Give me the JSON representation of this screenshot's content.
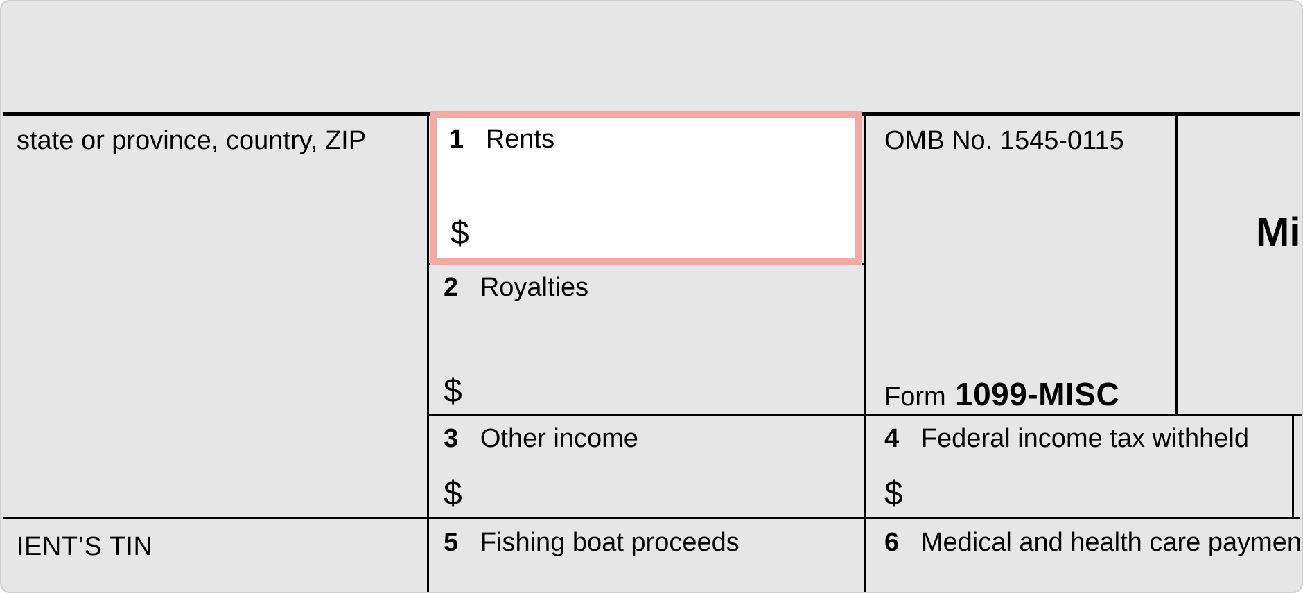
{
  "payer_address_fragment": "state or province, country, ZIP",
  "omb_number": "OMB No. 1545-0115",
  "title_fragment": "Mis",
  "form_label_word": "Form",
  "form_code": "1099-MISC",
  "currency_symbol": "$",
  "recipient_tin_fragment": "IENT’S TIN",
  "boxes": {
    "b1": {
      "num": "1",
      "label": "Rents"
    },
    "b2": {
      "num": "2",
      "label": "Royalties"
    },
    "b3": {
      "num": "3",
      "label": "Other income"
    },
    "b4": {
      "num": "4",
      "label": "Federal income tax withheld"
    },
    "b5": {
      "num": "5",
      "label": "Fishing boat proceeds"
    },
    "b6": {
      "num": "6",
      "label": "Medical and health care payments"
    }
  }
}
